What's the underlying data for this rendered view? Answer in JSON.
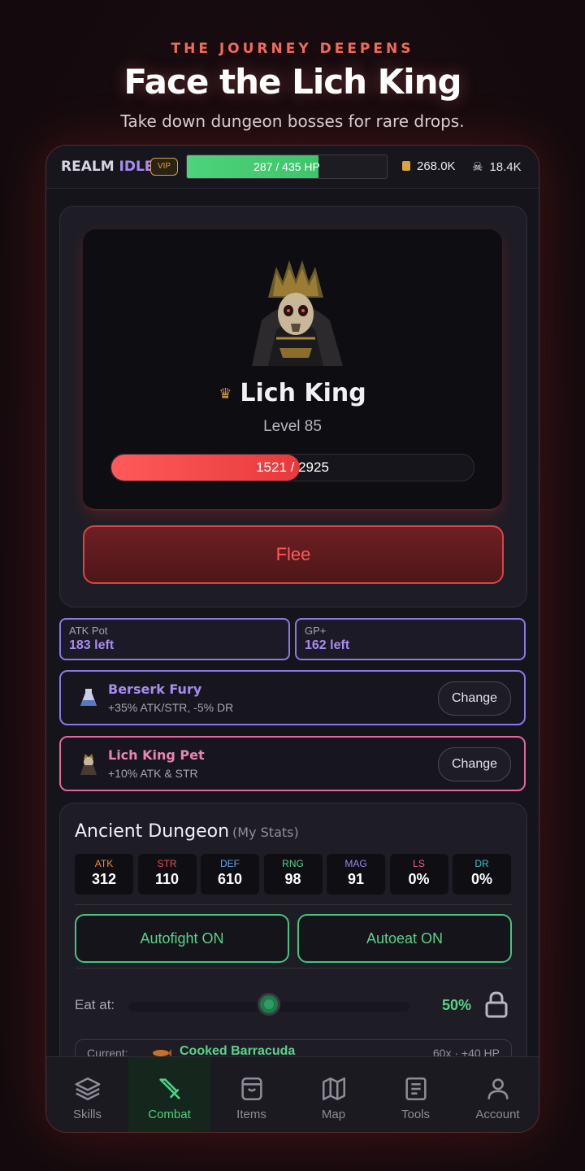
{
  "promo": {
    "eyebrow": "THE JOURNEY DEEPENS",
    "title": "Face the Lich King",
    "subtitle": "Take down dungeon bosses for rare drops."
  },
  "topbar": {
    "logo_part1": "REALM",
    "logo_part2": "IDLE",
    "vip_badge": "VIP",
    "player_hp_text": "287 / 435 HP",
    "player_hp_fraction": 0.66,
    "gold": "268.0K",
    "gold_icon": "gold-bar-icon",
    "kills": "18.4K",
    "kills_icon": "skull-icon"
  },
  "boss": {
    "name": "Lich King",
    "level": "Level 85",
    "hp_text": "1521 / 2925",
    "hp_fraction": 0.52,
    "flee_label": "Flee"
  },
  "potions": [
    {
      "label": "ATK Pot",
      "value": "183 left"
    },
    {
      "label": "GP+",
      "value": "162 left"
    }
  ],
  "slots": [
    {
      "name": "Berserk Fury",
      "desc": "+35% ATK/STR, -5% DR",
      "button": "Change",
      "color": "#8c77e8",
      "name_color": "#a98bf0"
    },
    {
      "name": "Lich King Pet",
      "desc": "+10% ATK & STR",
      "button": "Change",
      "color": "#e0689a",
      "name_color": "#e785b0"
    }
  ],
  "dungeon": {
    "title": "Ancient Dungeon",
    "subtitle": "(My Stats)",
    "stats": [
      {
        "key": "ATK",
        "value": "312",
        "color": "#f08a3a"
      },
      {
        "key": "STR",
        "value": "110",
        "color": "#ef4f4f"
      },
      {
        "key": "DEF",
        "value": "610",
        "color": "#5aa6f0"
      },
      {
        "key": "RNG",
        "value": "98",
        "color": "#57d48a"
      },
      {
        "key": "MAG",
        "value": "91",
        "color": "#9b86f0"
      },
      {
        "key": "LS",
        "value": "0%",
        "color": "#ef5f8a"
      },
      {
        "key": "DR",
        "value": "0%",
        "color": "#3fc4c0"
      }
    ],
    "autofight": "Autofight ON",
    "autoeat": "Autoeat ON",
    "eat_label": "Eat at:",
    "eat_value": "50%",
    "eat_fraction": 0.5,
    "current_label": "Current:",
    "current_food": "Cooked Barracuda",
    "current_qty": "60x · +40 HP"
  },
  "nav": [
    {
      "label": "Skills",
      "icon": "layers-icon"
    },
    {
      "label": "Combat",
      "icon": "sword-icon",
      "active": true
    },
    {
      "label": "Items",
      "icon": "bag-icon"
    },
    {
      "label": "Map",
      "icon": "map-icon"
    },
    {
      "label": "Tools",
      "icon": "clipboard-icon"
    },
    {
      "label": "Account",
      "icon": "user-icon"
    }
  ]
}
